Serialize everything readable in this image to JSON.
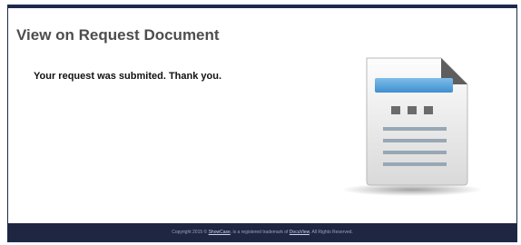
{
  "page": {
    "title": "View on Request Document",
    "message": "Your request was submited. Thank you."
  },
  "footer": {
    "text_before": "Copyright 2015 © ",
    "link1": "ShowCase",
    "text_middle": ", is a registered trademark of ",
    "link2": "DocuView",
    "text_after": ". All Rights Reserved."
  },
  "icon": {
    "name": "document-icon"
  },
  "colors": {
    "frame_border": "#1d2a4e",
    "footer_bg": "#1f2641",
    "title_text": "#4d4d4d",
    "doc_bar": "#4d9fd9"
  }
}
